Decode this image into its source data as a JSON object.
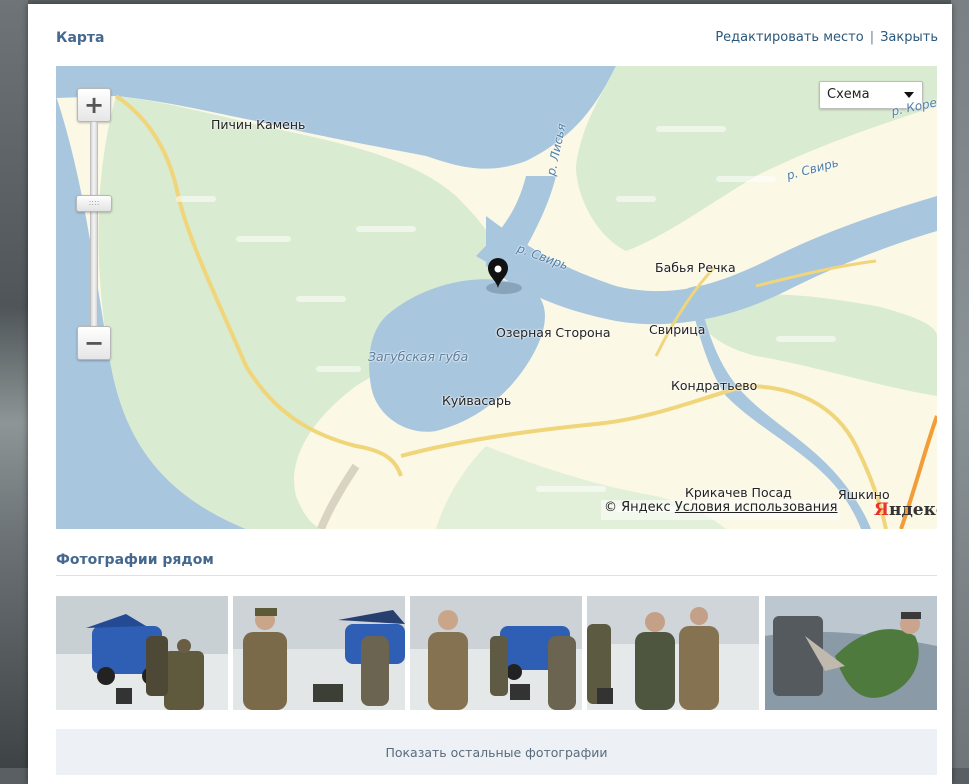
{
  "modal": {
    "title": "Карта",
    "edit_place_link": "Редактировать место",
    "separator": "|",
    "close_link": "Закрыть"
  },
  "map": {
    "zoom_in_label": "+",
    "zoom_out_label": "−",
    "layer_select_value": "Схема",
    "labels": {
      "pichin_kamen": "Пичин Камень",
      "lisya": "р. Лисья",
      "svir_1": "р. Свирь",
      "svir_2": "р. Свирь",
      "svir_corner": "р. Коре",
      "babya_rechka": "Бабья Речка",
      "ozernaya_storona": "Озерная Сторона",
      "svirica": "Свирица",
      "zagubskaya_guba": "Загубская губа",
      "kuyvasar": "Куйвасарь",
      "kondratyevo": "Кондратьево",
      "krikachev_posad": "Крикачев Посад",
      "yashkino": "Яшкино"
    },
    "attribution": "© Яндекс",
    "terms_link": "Условия использования",
    "logo": {
      "first": "Я",
      "rest": "ндекс"
    },
    "colors": {
      "water": "#a8c6de",
      "land": "#fbf8e6",
      "forest": "#d9ebd0",
      "road": "#f0d57a"
    }
  },
  "photos_section": {
    "title": "Фотографии рядом",
    "show_more": "Показать остальные фотографии"
  }
}
